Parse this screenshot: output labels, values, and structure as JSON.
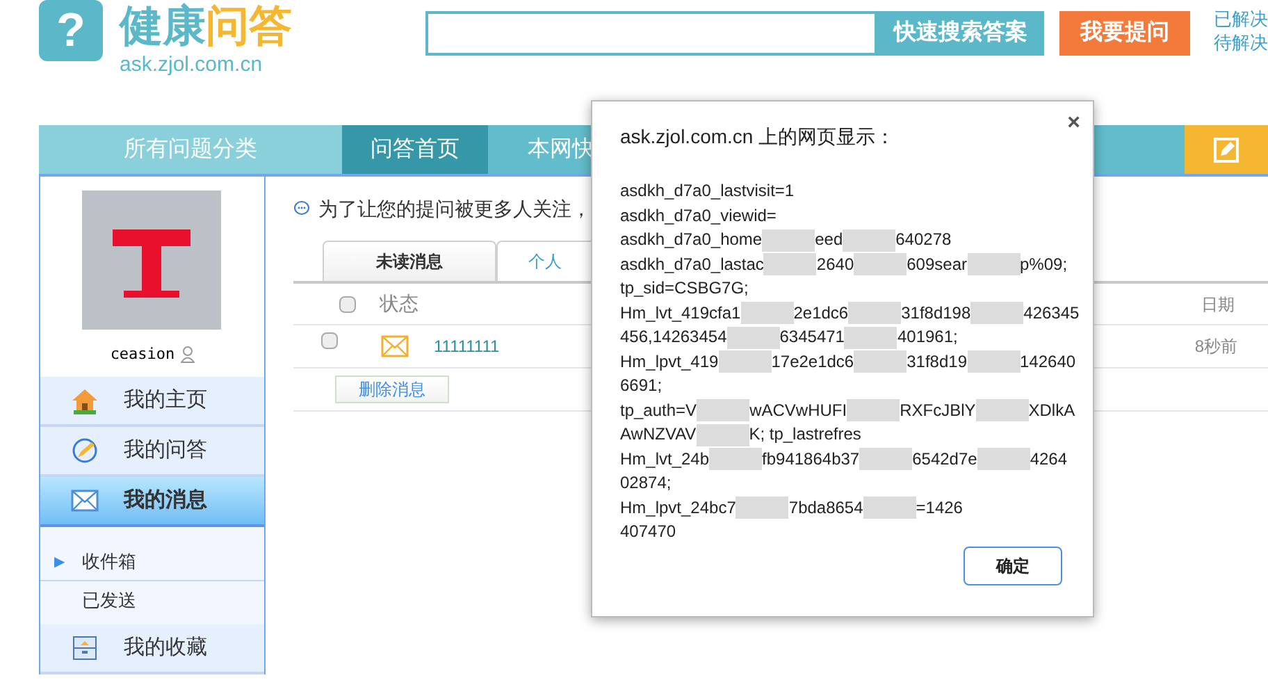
{
  "header": {
    "logo_mark": "?",
    "logo_name_1": "健康",
    "logo_name_2": "问答",
    "logo_url": "ask.zjol.com.cn",
    "search_button": "快速搜索答案",
    "ask_button": "我要提问",
    "links": [
      "已解决",
      "待解决"
    ]
  },
  "nav": {
    "tabs": [
      {
        "label": "所有问题分类",
        "kind": "category",
        "selected": false
      },
      {
        "label": "问答首页",
        "kind": "tab",
        "selected": true
      },
      {
        "label": "本网快",
        "kind": "tab",
        "selected": false
      }
    ]
  },
  "sidebar": {
    "username": "ceasion",
    "current_marker": "▶",
    "menu": [
      {
        "label": "我的主页",
        "selected": false
      },
      {
        "label": "我的问答",
        "selected": false
      },
      {
        "label": "我的消息",
        "selected": true,
        "expanded": true,
        "children": [
          {
            "label": "收件箱",
            "selected": true
          },
          {
            "label": "已发送",
            "selected": false
          }
        ]
      },
      {
        "label": "我的收藏",
        "selected": false
      }
    ]
  },
  "content": {
    "tip": "为了让您的提问被更多人关注，",
    "tabs": [
      {
        "label": "未读消息",
        "selected": true
      },
      {
        "label": "个人",
        "selected": false
      }
    ],
    "table": {
      "select_all_checked": false,
      "columns": [
        "状态",
        "日期"
      ],
      "rows": [
        {
          "checked": false,
          "unread": true,
          "title": "11111111",
          "date": "8秒前"
        }
      ]
    },
    "delete_button": "删除消息"
  },
  "dialog": {
    "title": "ask.zjol.com.cn 上的网页显示：",
    "close": "×",
    "lines": [
      [
        "asdkh_d7a0_lastvisit=1"
      ],
      [
        "asdkh_d7a0_viewid="
      ],
      [
        "asdkh_d7a0_home",
        "eed",
        "640278"
      ],
      [
        "asdkh_d7a0_lastac",
        "2640",
        "609sear",
        "p%09;"
      ],
      [
        "tp_sid=CSBG7G;"
      ],
      [
        "Hm_lvt_419cfa1",
        "2e1dc6",
        "31f8d198",
        "426345"
      ],
      [
        "456,14263454",
        "6345471",
        "401961;"
      ],
      [
        "Hm_lpvt_419",
        "17e2e1dc6",
        "31f8d19",
        "142640"
      ],
      [
        "6691;"
      ],
      [
        "tp_auth=V",
        "wACVwHUFI",
        "RXFcJBlY",
        "XDlkA"
      ],
      [
        "AwNZVAV",
        "K; tp_lastrefres"
      ],
      [
        "Hm_lvt_24b",
        "fb941864b37",
        "6542d7e",
        "4264"
      ],
      [
        "02874;"
      ],
      [
        "Hm_lpvt_24bc7",
        "7bda8654",
        "=1426"
      ],
      [
        "407470"
      ]
    ],
    "ok_button": "确定"
  }
}
